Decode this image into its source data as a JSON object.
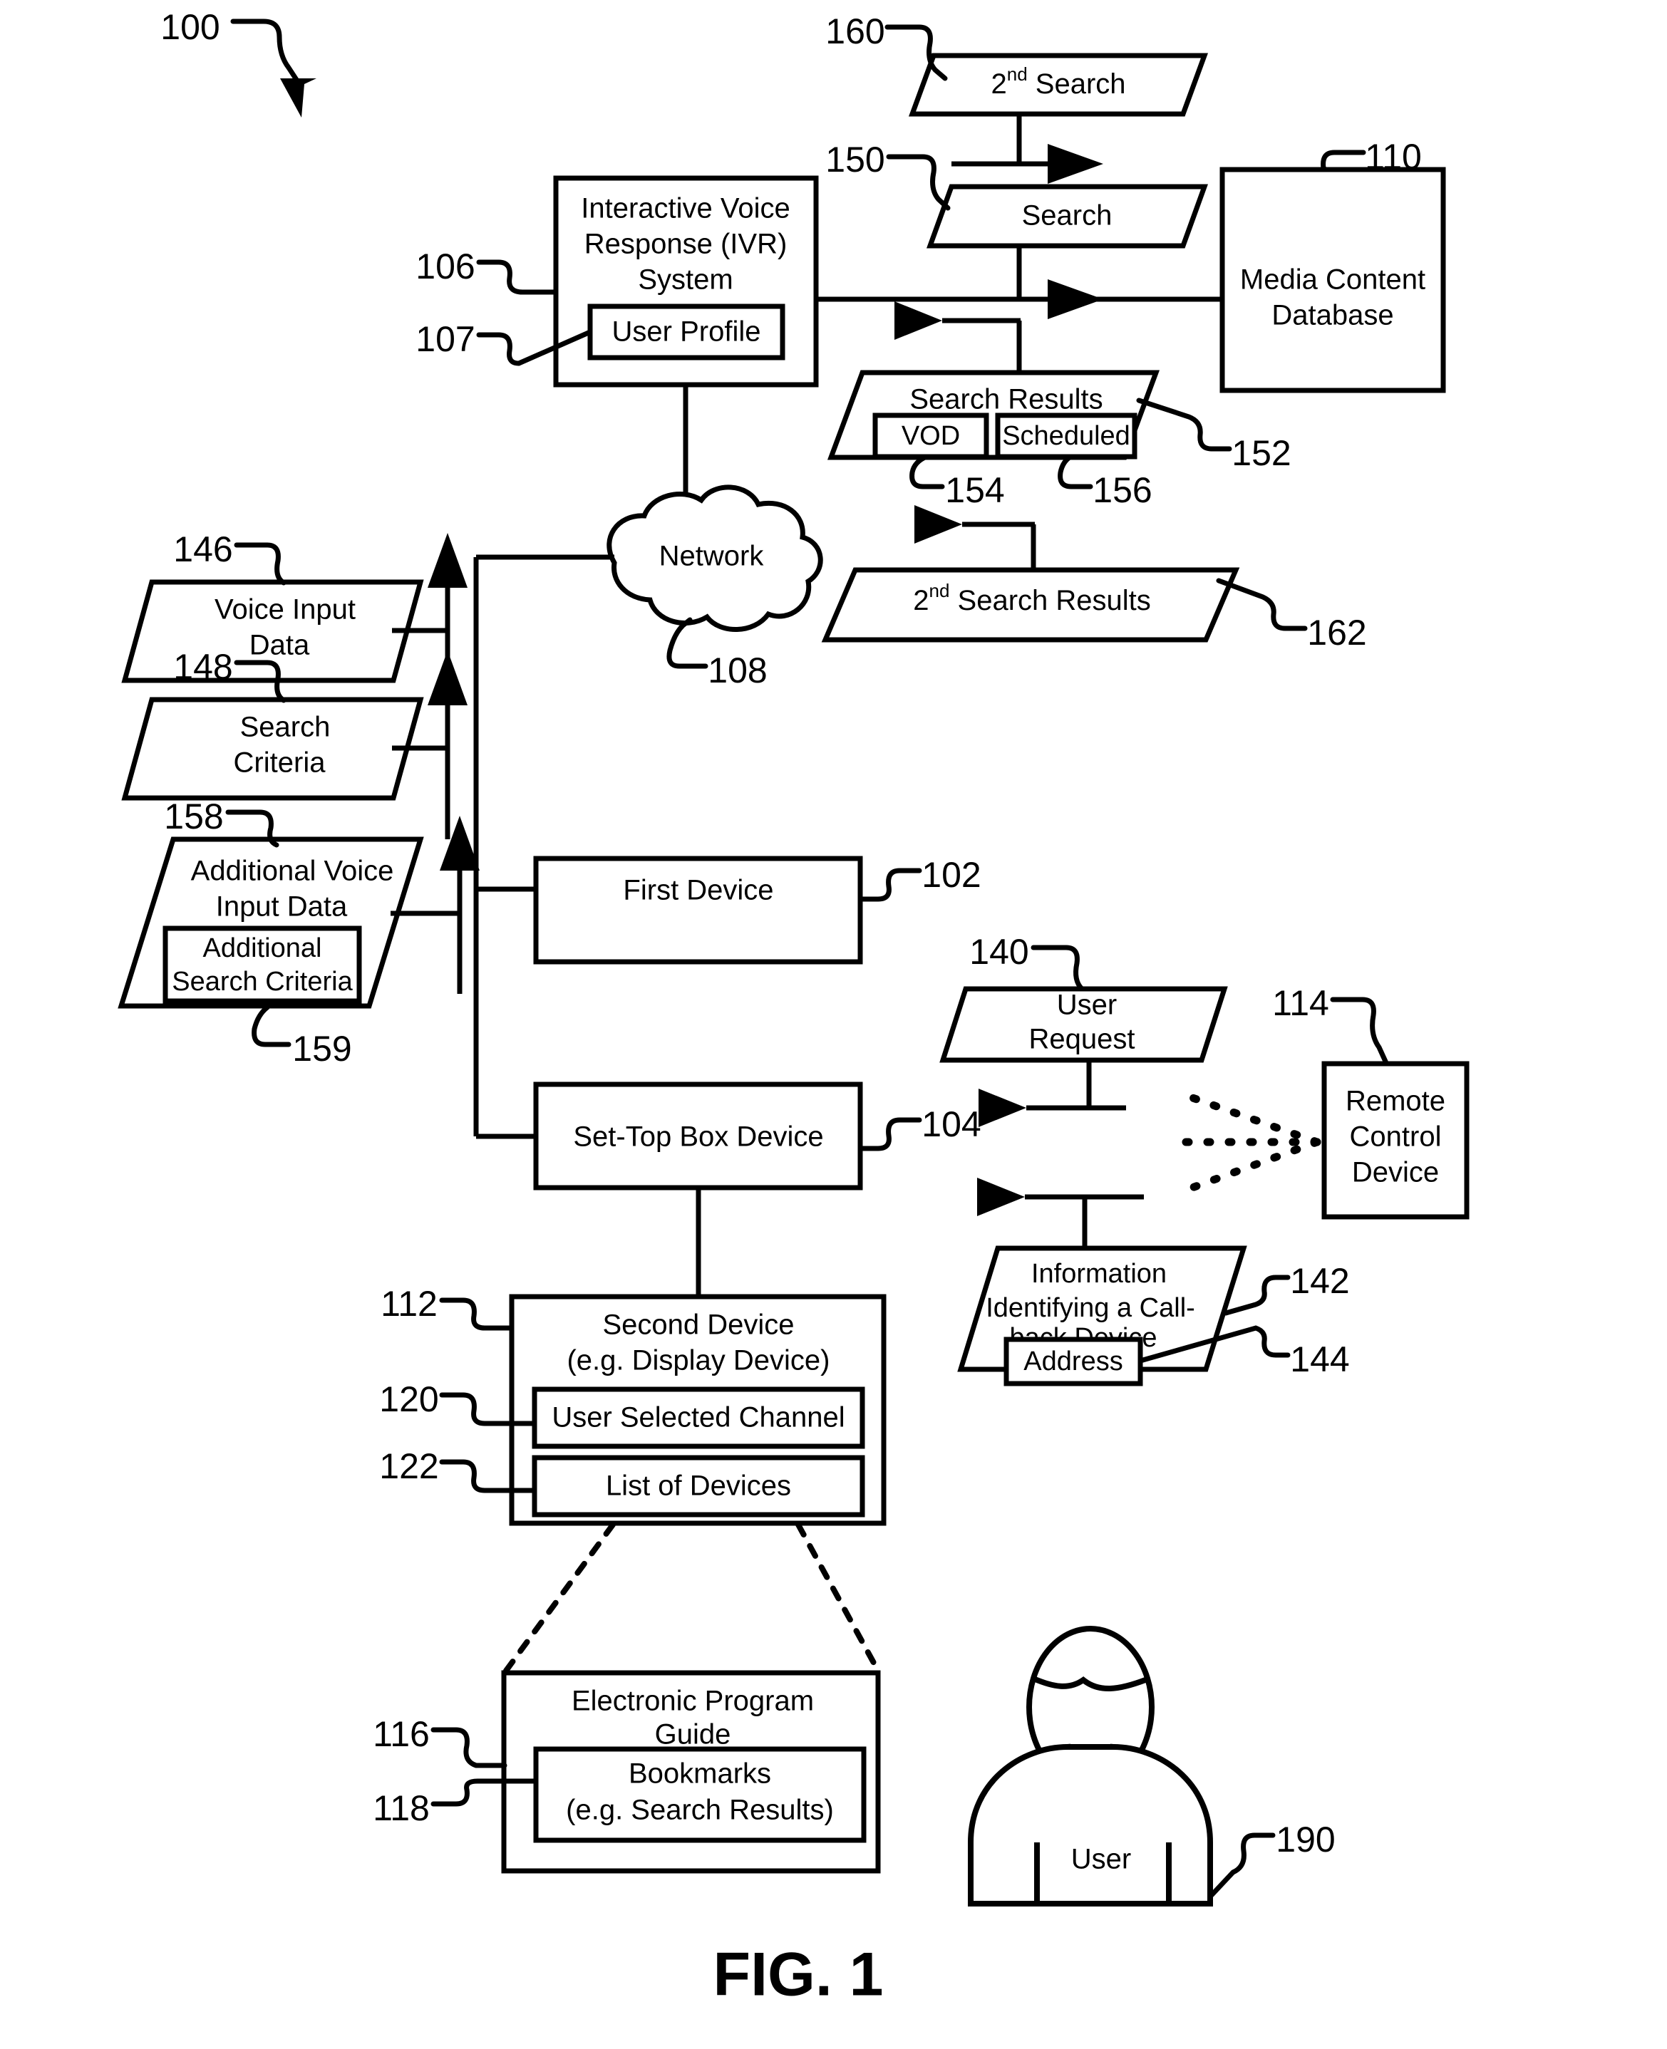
{
  "figure": {
    "caption": "FIG. 1",
    "system_ref": "100"
  },
  "nodes": {
    "ivr_system": {
      "label_line1": "Interactive Voice",
      "label_line2": "Response (IVR)",
      "label_line3": "System",
      "ref": "106"
    },
    "user_profile": {
      "label": "User Profile",
      "ref": "107"
    },
    "media_content_database": {
      "label_line1": "Media Content",
      "label_line2": "Database",
      "ref": "110"
    },
    "second_search": {
      "label_prefix": "2",
      "label_sup": "nd",
      "label_suffix": " Search",
      "ref": "160"
    },
    "search": {
      "label": "Search",
      "ref": "150"
    },
    "search_results": {
      "label": "Search Results",
      "ref": "152"
    },
    "vod": {
      "label": "VOD",
      "ref": "154"
    },
    "scheduled": {
      "label": "Scheduled",
      "ref": "156"
    },
    "second_search_results": {
      "label_prefix": "2",
      "label_sup": "nd",
      "label_suffix": " Search Results",
      "ref": "162"
    },
    "network": {
      "label": "Network",
      "ref": "108"
    },
    "voice_input_data": {
      "label_line1": "Voice Input",
      "label_line2": "Data",
      "ref": "146"
    },
    "search_criteria": {
      "label_line1": "Search",
      "label_line2": "Criteria",
      "ref": "148"
    },
    "additional_voice_input_data": {
      "label_line1": "Additional Voice",
      "label_line2": "Input Data",
      "ref": "158"
    },
    "additional_search_criteria": {
      "label_line1": "Additional",
      "label_line2": "Search Criteria",
      "ref": "159"
    },
    "first_device": {
      "label": "First Device",
      "ref": "102"
    },
    "set_top_box_device": {
      "label": "Set-Top Box Device",
      "ref": "104"
    },
    "user_request": {
      "label_line1": "User",
      "label_line2": "Request",
      "ref": "140"
    },
    "remote_control_device": {
      "label_line1": "Remote",
      "label_line2": "Control",
      "label_line3": "Device",
      "ref": "114"
    },
    "callback_info": {
      "label_line1": "Information",
      "label_line2": "Identifying a Call-",
      "label_line3": "back Device",
      "ref": "142"
    },
    "address": {
      "label": "Address",
      "ref": "144"
    },
    "second_device": {
      "label_line1": "Second Device",
      "label_line2": "(e.g. Display Device)",
      "ref": "112"
    },
    "user_selected_channel": {
      "label": "User Selected Channel",
      "ref": "120"
    },
    "list_of_devices": {
      "label": "List of Devices",
      "ref": "122"
    },
    "electronic_program_guide": {
      "label_line1": "Electronic Program",
      "label_line2": "Guide",
      "ref": "116"
    },
    "bookmarks": {
      "label_line1": "Bookmarks",
      "label_line2": "(e.g. Search Results)",
      "ref": "118"
    },
    "user": {
      "label": "User",
      "ref": "190"
    }
  },
  "colors": {
    "stroke": "#000000",
    "fill": "#ffffff"
  }
}
